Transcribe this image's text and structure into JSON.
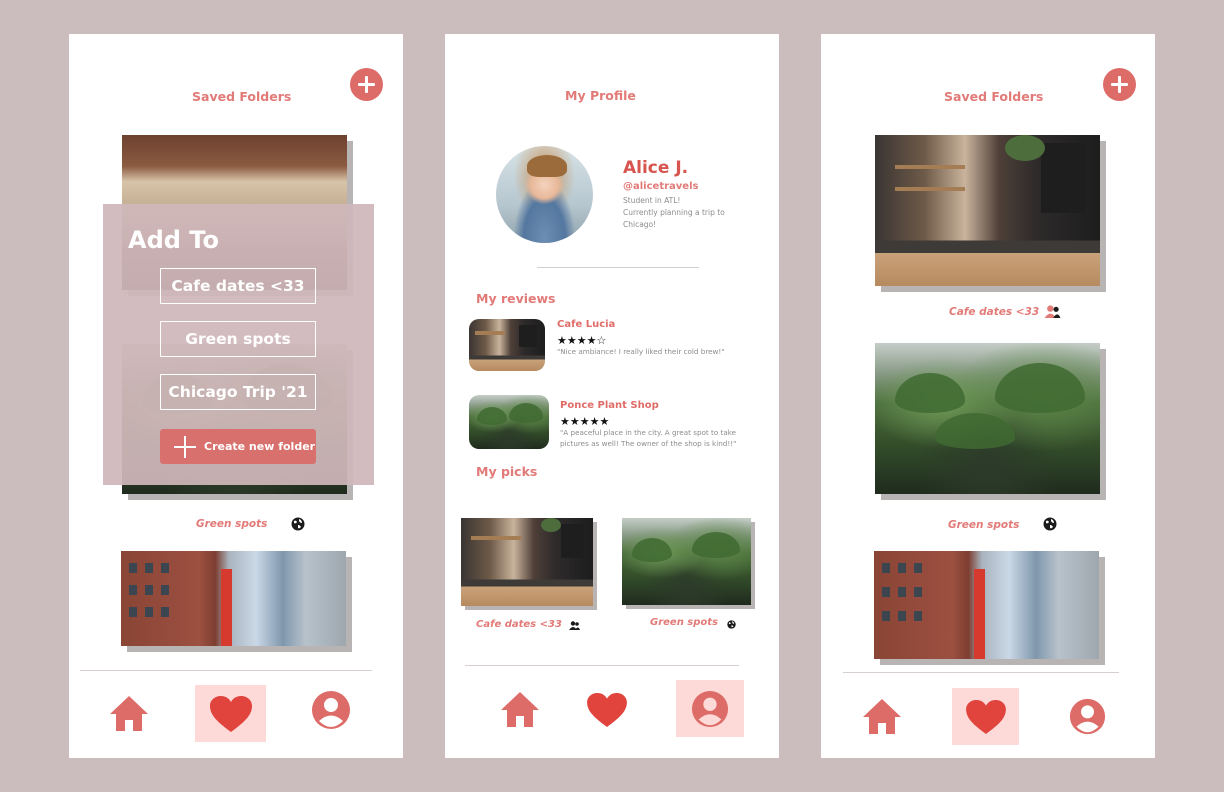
{
  "colors": {
    "accent": "#dd6b67",
    "title": "#e27a77",
    "active_nav_bg": "#fdd9d8",
    "overlay": "#d0b7ba",
    "background": "#cbbcbd"
  },
  "screen1": {
    "title": "Saved Folders",
    "add_icon": "plus-circle-icon",
    "folders": [
      {
        "caption": "Green spots",
        "icon": "globe-icon"
      }
    ],
    "overlay": {
      "heading": "Add To",
      "options": [
        "Cafe dates <33",
        "Green spots",
        "Chicago Trip '21"
      ],
      "create_label": "Create new folder"
    },
    "nav": {
      "active": "favorites"
    }
  },
  "screen2": {
    "title": "My Profile",
    "profile": {
      "name": "Alice J.",
      "handle": "@alicetravels",
      "bio_line1": "Student in ATL!",
      "bio_line2": "Currently planning a trip to Chicago!"
    },
    "reviews_heading": "My reviews",
    "reviews": [
      {
        "title": "Cafe Lucia",
        "stars": "★★★★☆",
        "rating": 4,
        "text": "\"Nice ambiance! I really liked their cold brew!\""
      },
      {
        "title": "Ponce Plant Shop",
        "stars": "★★★★★",
        "rating": 5,
        "text": "\"A peaceful place in the city. A great spot to take pictures as well! The owner of the shop is kind!!\""
      }
    ],
    "picks_heading": "My picks",
    "picks": [
      {
        "caption": "Cafe dates <33",
        "icon": "people-icon"
      },
      {
        "caption": "Green spots",
        "icon": "globe-icon"
      }
    ],
    "nav": {
      "active": "profile"
    }
  },
  "screen3": {
    "title": "Saved Folders",
    "add_icon": "plus-circle-icon",
    "folders": [
      {
        "caption": "Cafe dates <33",
        "icon": "people-icon"
      },
      {
        "caption": "Green spots",
        "icon": "globe-icon"
      }
    ],
    "nav": {
      "active": "favorites"
    }
  }
}
